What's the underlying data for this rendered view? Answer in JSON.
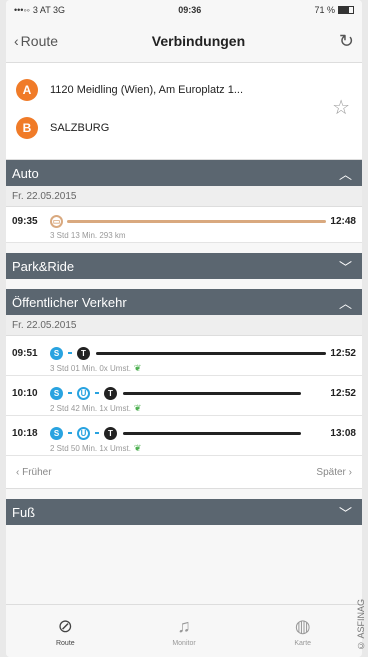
{
  "status": {
    "carrier": "3 AT 3G",
    "time": "09:36",
    "battery": "71 %"
  },
  "nav": {
    "back": "Route",
    "title": "Verbindungen"
  },
  "route": {
    "from_marker": "A",
    "from": "1120 Meidling (Wien), Am Europlatz 1...",
    "to_marker": "B",
    "to": "SALZBURG"
  },
  "sections": {
    "auto": {
      "title": "Auto",
      "date": "Fr. 22.05.2015",
      "dep": "09:35",
      "arr": "12:48",
      "info": "3 Std 13 Min. 293 km"
    },
    "parkride": {
      "title": "Park&Ride"
    },
    "oev": {
      "title": "Öffentlicher Verkehr",
      "date": "Fr. 22.05.2015"
    },
    "fuss": {
      "title": "Fuß"
    }
  },
  "connections": [
    {
      "dep": "09:51",
      "arr": "12:52",
      "info": "3 Std 01 Min. 0x Umst."
    },
    {
      "dep": "10:10",
      "arr": "12:52",
      "info": "2 Std 42 Min. 1x Umst."
    },
    {
      "dep": "10:18",
      "arr": "13:08",
      "info": "2 Std 50 Min. 1x Umst."
    }
  ],
  "icons": {
    "s": "S",
    "u": "U",
    "t": "T"
  },
  "pager": {
    "prev": "Früher",
    "next": "Später"
  },
  "tabs": {
    "route": "Route",
    "monitor": "Monitor",
    "karte": "Karte"
  },
  "copyright": "© ASFINAG",
  "colors": {
    "header": "#5b6670",
    "accent": "#f07b28",
    "transit": "#29a3e0"
  }
}
